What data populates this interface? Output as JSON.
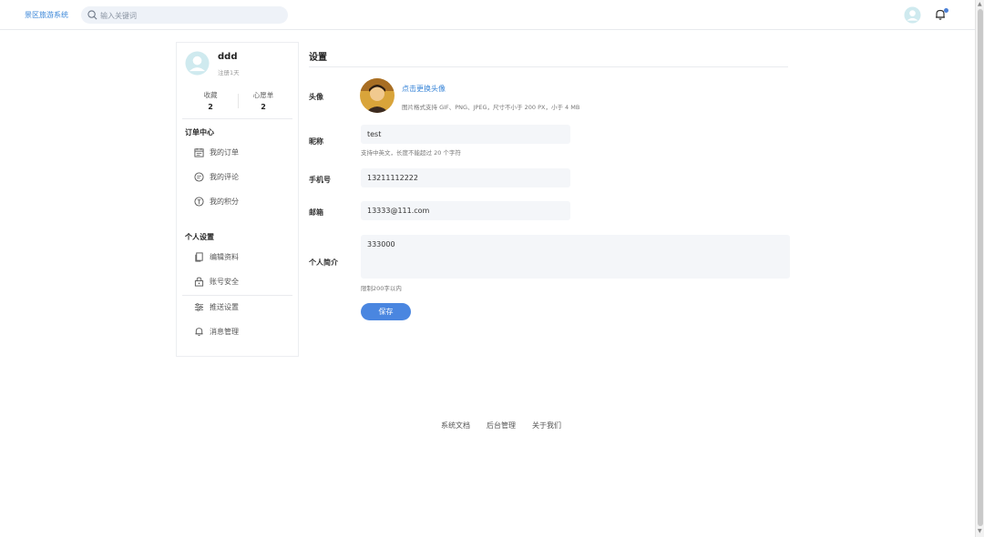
{
  "header": {
    "logo": "景区旅游系统",
    "search_placeholder": "输入关键词"
  },
  "sidebar": {
    "username": "ddd",
    "registered": "注册1天",
    "stats": [
      {
        "label": "收藏",
        "value": "2"
      },
      {
        "label": "心愿单",
        "value": "2"
      }
    ],
    "order_section": "订单中心",
    "order_items": [
      {
        "label": "我的订单",
        "icon": "calendar-icon"
      },
      {
        "label": "我的评论",
        "icon": "comment-icon"
      },
      {
        "label": "我的积分",
        "icon": "points-icon"
      }
    ],
    "personal_section": "个人设置",
    "personal_items": [
      {
        "label": "编辑资料",
        "icon": "edit-profile-icon"
      },
      {
        "label": "账号安全",
        "icon": "lock-icon"
      },
      {
        "label": "推送设置",
        "icon": "sliders-icon"
      },
      {
        "label": "消息管理",
        "icon": "bell-icon"
      }
    ]
  },
  "settings": {
    "title": "设置",
    "avatar_label": "头像",
    "avatar_change": "点击更换头像",
    "avatar_hint": "图片格式支持 GIF、PNG、JPEG，尺寸不小于 200 PX，小于 4 MB",
    "nickname_label": "昵称",
    "nickname_value": "test",
    "nickname_hint": "支持中英文，长度不能超过 20 个字符",
    "phone_label": "手机号",
    "phone_value": "13211112222",
    "email_label": "邮箱",
    "email_value": "13333@111.com",
    "bio_label": "个人简介",
    "bio_value": "333000",
    "bio_hint": "限制200字以内",
    "save_label": "保存"
  },
  "footer": {
    "links": [
      "系统文档",
      "后台管理",
      "关于我们"
    ]
  },
  "colors": {
    "accent": "#4a86e0",
    "link": "#3a86d8",
    "input_bg": "#f4f6f9"
  }
}
